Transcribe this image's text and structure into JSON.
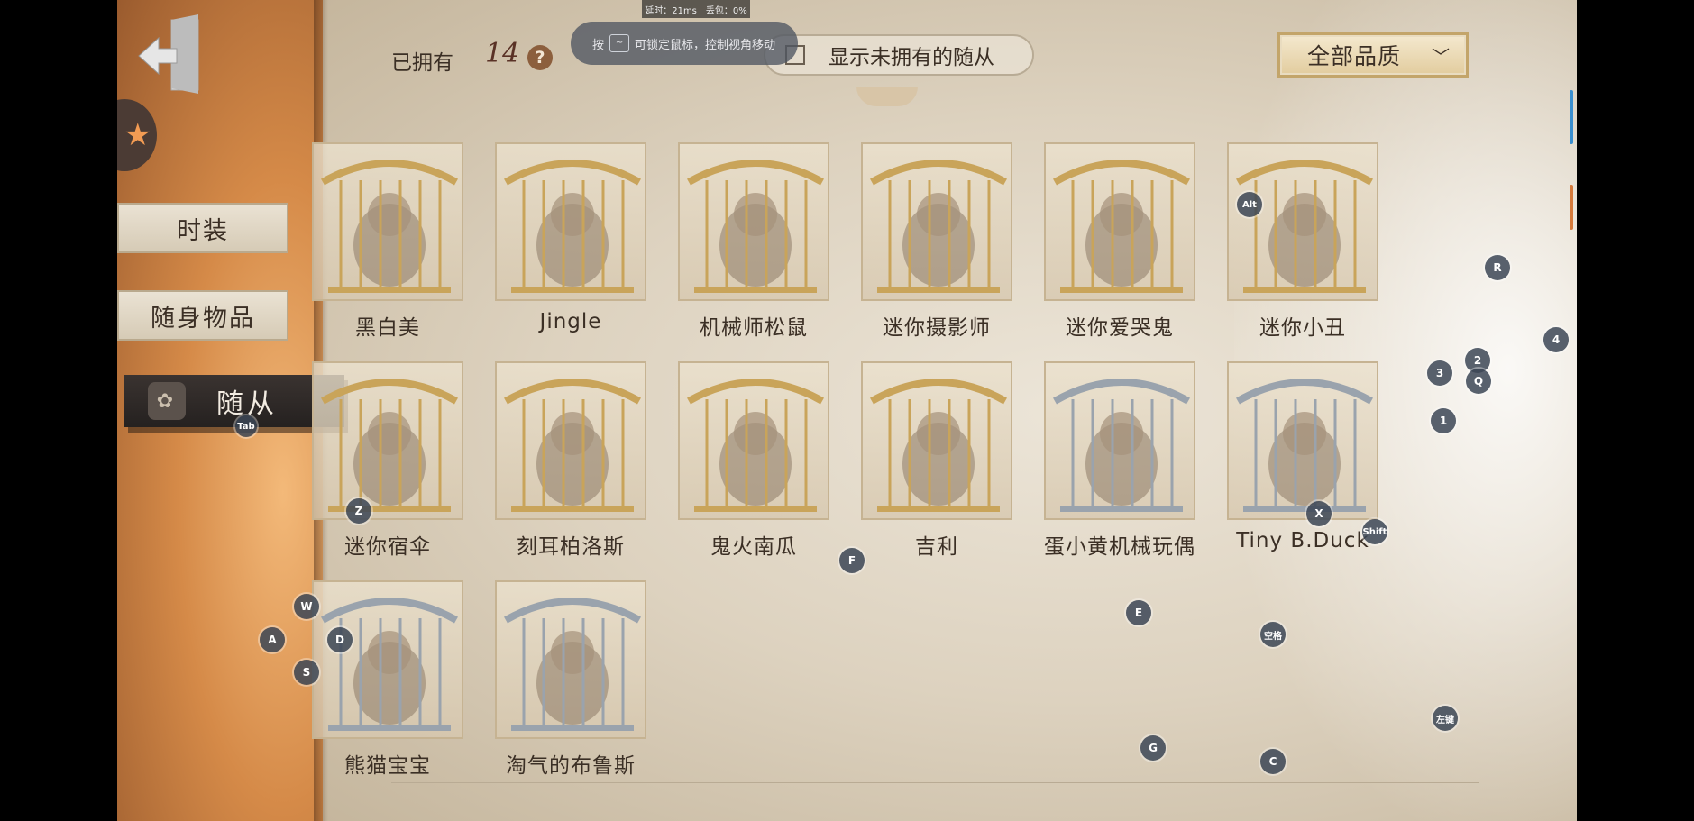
{
  "status": {
    "latency": "延时：21ms",
    "packet_loss": "丢包：0%"
  },
  "toast": {
    "prefix": "按",
    "key": "~",
    "text": "可锁定鼠标，控制视角移动"
  },
  "sidebar": {
    "tabs": [
      {
        "label": "时装"
      },
      {
        "label": "随身物品"
      },
      {
        "label": "随从"
      }
    ]
  },
  "header": {
    "owned_label": "已拥有",
    "owned_count": "14",
    "help": "?",
    "filter_label": "显示未拥有的随从",
    "quality_select": "全部品质"
  },
  "pets": [
    {
      "name": "黑白美",
      "cage": "gold"
    },
    {
      "name": "Jingle",
      "cage": "gold"
    },
    {
      "name": "机械师松鼠",
      "cage": "gold"
    },
    {
      "name": "迷你摄影师",
      "cage": "gold"
    },
    {
      "name": "迷你爱哭鬼",
      "cage": "gold"
    },
    {
      "name": "迷你小丑",
      "cage": "gold"
    },
    {
      "name": "迷你宿伞",
      "cage": "gold"
    },
    {
      "name": "刻耳柏洛斯",
      "cage": "gold"
    },
    {
      "name": "鬼火南瓜",
      "cage": "gold"
    },
    {
      "name": "吉利",
      "cage": "gold"
    },
    {
      "name": "蛋小黄机械玩偶",
      "cage": "silver"
    },
    {
      "name": "Tiny B.Duck",
      "cage": "silver"
    },
    {
      "name": "熊猫宝宝",
      "cage": "silver"
    },
    {
      "name": "淘气的布鲁斯",
      "cage": "silver"
    }
  ],
  "key_hints": [
    "Tab",
    "Z",
    "W",
    "A",
    "S",
    "D",
    "F",
    "E",
    "G",
    "C",
    "X",
    "Shift",
    "Alt",
    "R",
    "1",
    "2",
    "3",
    "4",
    "Q",
    "空格",
    "左键"
  ],
  "colors": {
    "gold_cage": "#c9a45a",
    "silver_cage": "#9aa3ad",
    "active_tab": "#2f2a28"
  }
}
